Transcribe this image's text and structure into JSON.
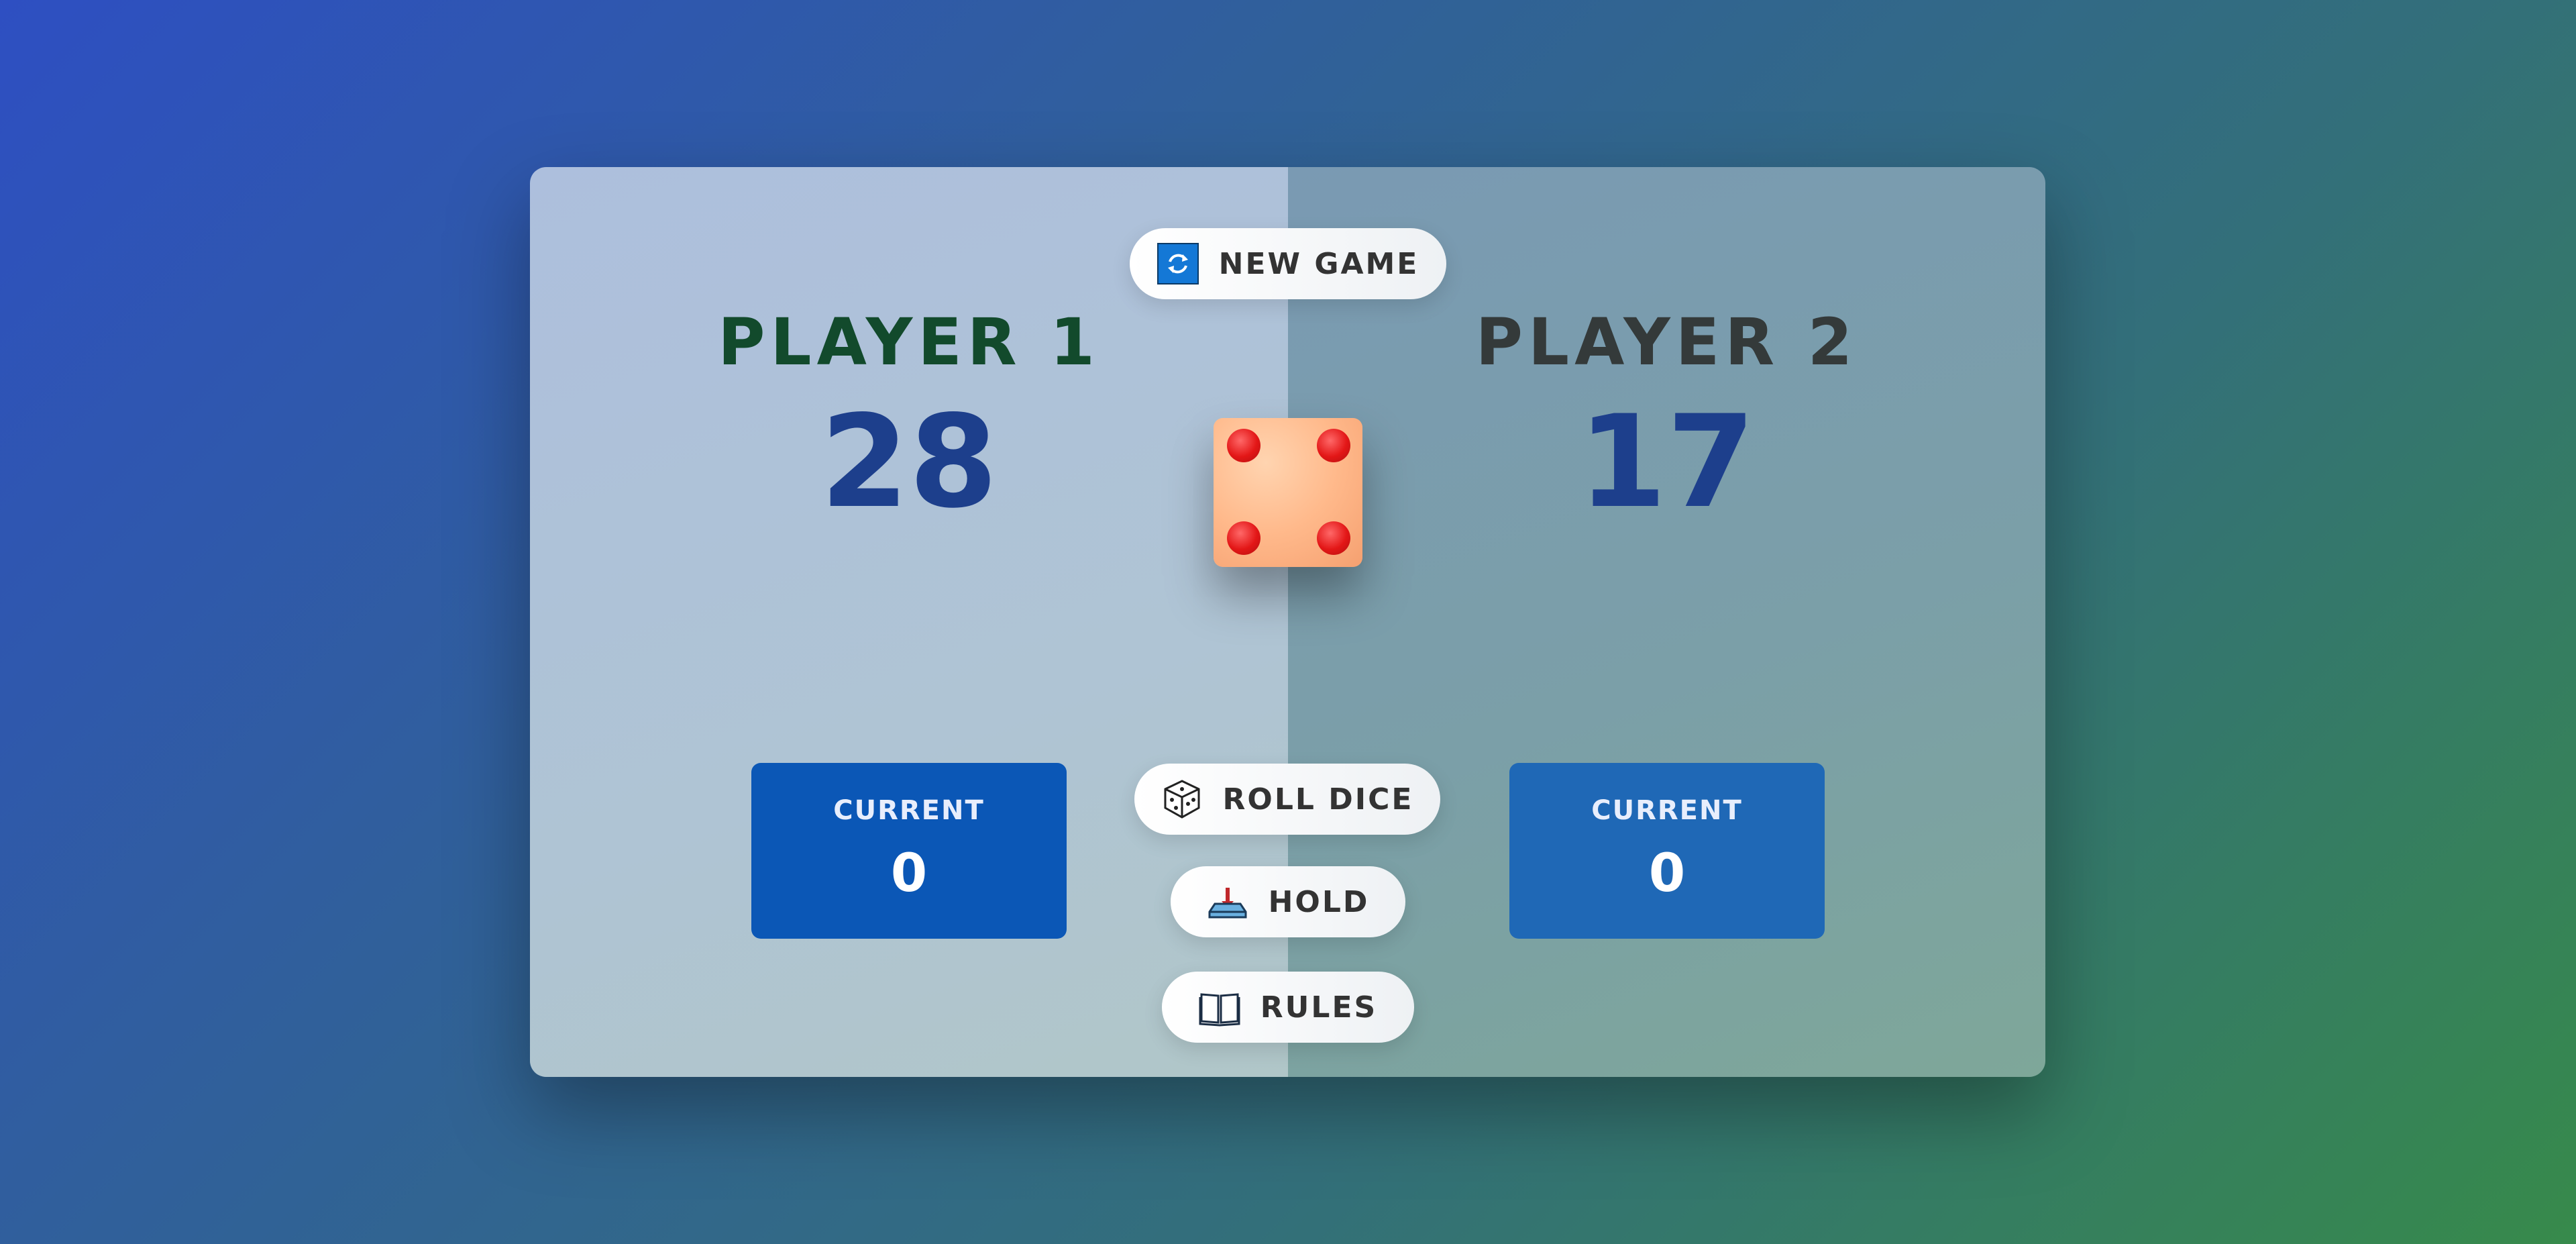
{
  "players": [
    {
      "name": "PLAYER 1",
      "score": "28",
      "current_label": "CURRENT",
      "current_value": "0"
    },
    {
      "name": "PLAYER 2",
      "score": "17",
      "current_label": "CURRENT",
      "current_value": "0"
    }
  ],
  "buttons": {
    "new_game": "NEW GAME",
    "roll_dice": "ROLL DICE",
    "hold": "HOLD",
    "rules": "RULES"
  },
  "dice": {
    "value": 4
  },
  "colors": {
    "player1_name": "#124a2c",
    "player2_name": "#343a3a",
    "score": "#1d3f8c",
    "current_box_p1": "#0b57b6",
    "current_box_p2": "#1f68b6",
    "pip": "#e31717"
  },
  "icons": {
    "new_game": "refresh-icon",
    "roll_dice": "dice-icon",
    "hold": "hold-icon",
    "rules": "book-icon"
  }
}
